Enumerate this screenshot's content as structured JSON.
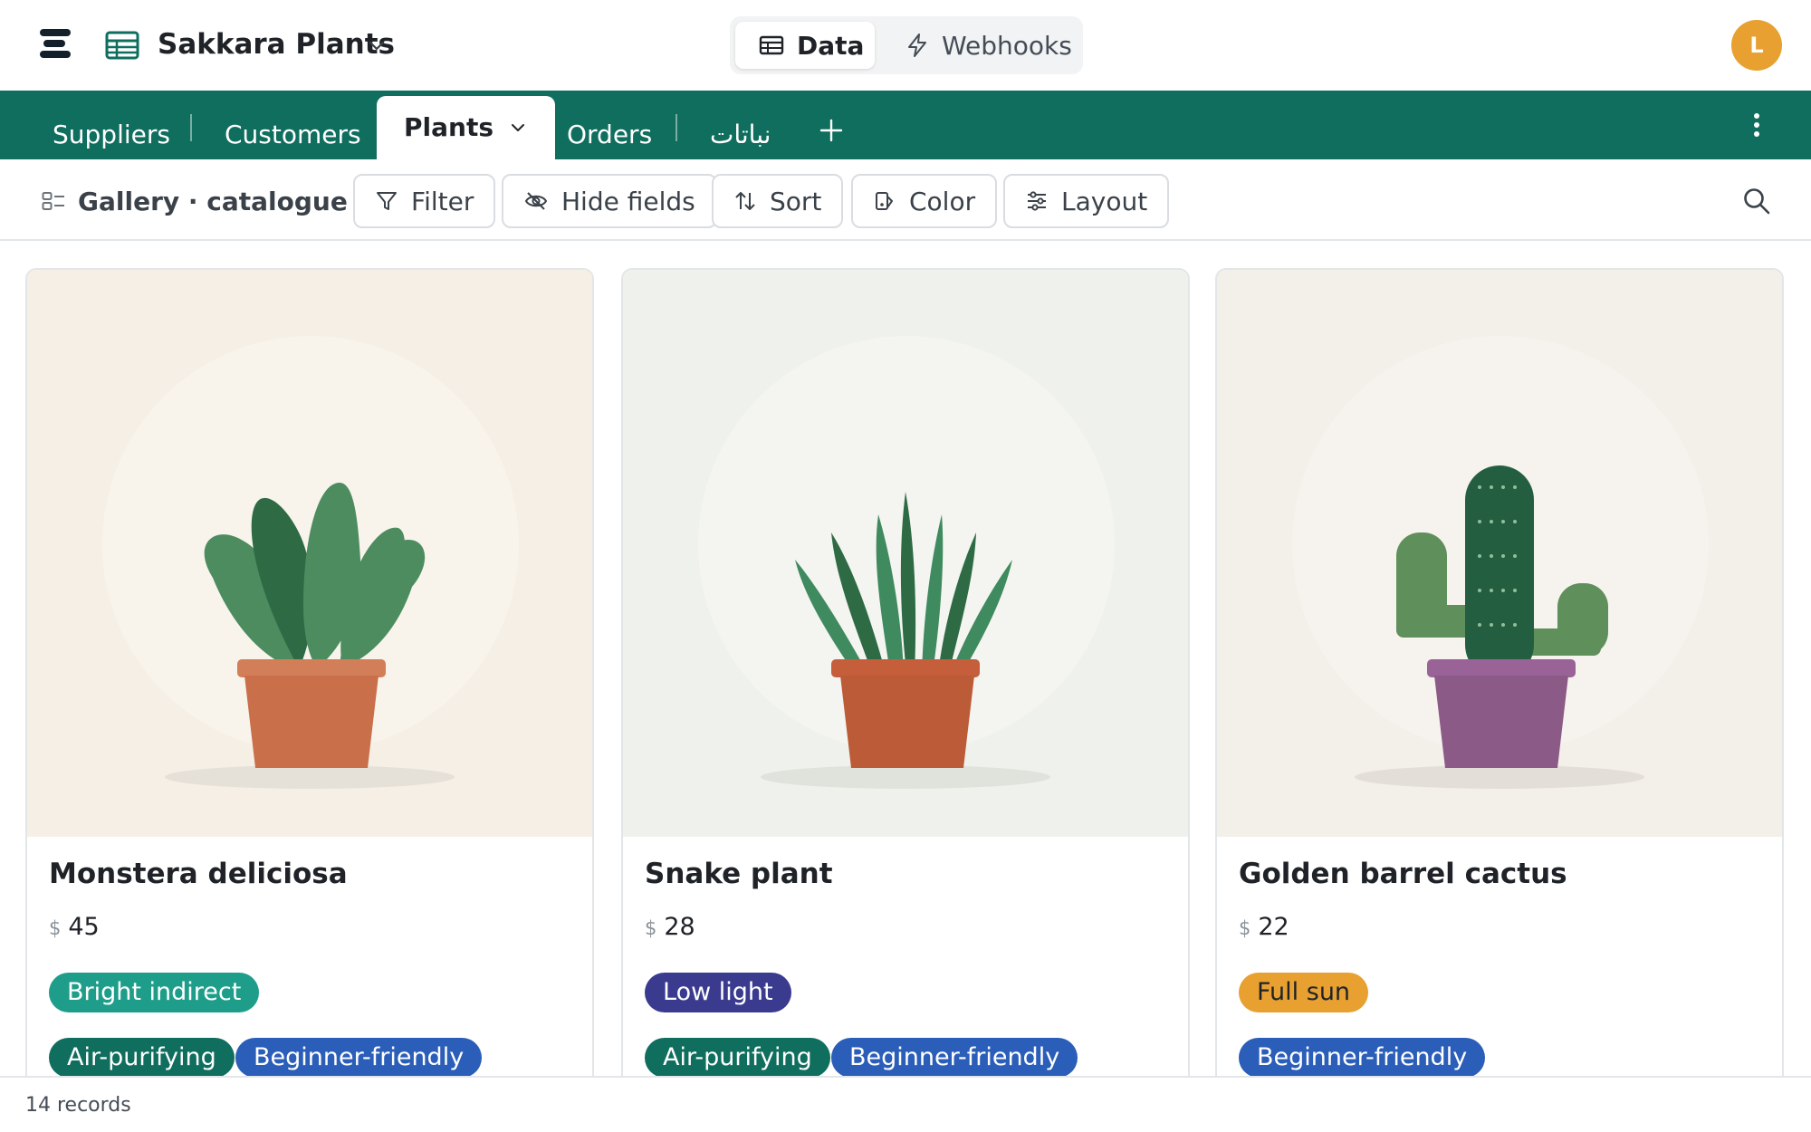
{
  "app": {
    "base_name": "Sakkara Plants",
    "avatar_initial": "L",
    "mode_tabs": [
      {
        "label": "Data",
        "icon": "table-icon",
        "active": true
      },
      {
        "label": "Webhooks",
        "icon": "lightning-icon",
        "active": false
      }
    ]
  },
  "tables": [
    {
      "label": "Suppliers",
      "active": false
    },
    {
      "label": "Customers",
      "active": false
    },
    {
      "label": "Plants",
      "active": true
    },
    {
      "label": "Orders",
      "active": false
    },
    {
      "label": "نباتات",
      "active": false
    }
  ],
  "toolbar": {
    "view_label": "Gallery · catalogue",
    "filter": "Filter",
    "hide_fields": "Hide fields",
    "sort": "Sort",
    "color": "Color",
    "layout": "Layout"
  },
  "cards": [
    {
      "title": "Monstera deliciosa",
      "currency": "$",
      "price": "45",
      "light": {
        "label": "Bright indirect",
        "color": "#1e9e8a"
      },
      "tags": [
        {
          "label": "Air-purifying",
          "color": "#0f6e5e"
        },
        {
          "label": "Beginner-friendly",
          "color": "#2b5eb8"
        }
      ],
      "image_icon": "monstera-plant-icon"
    },
    {
      "title": "Snake plant",
      "currency": "$",
      "price": "28",
      "light": {
        "label": "Low light",
        "color": "#3a3b8f"
      },
      "tags": [
        {
          "label": "Air-purifying",
          "color": "#0f6e5e"
        },
        {
          "label": "Beginner-friendly",
          "color": "#2b5eb8"
        }
      ],
      "image_icon": "snake-plant-icon"
    },
    {
      "title": "Golden barrel cactus",
      "currency": "$",
      "price": "22",
      "light": {
        "label": "Full sun",
        "color": "#e8a030"
      },
      "tags": [
        {
          "label": "Beginner-friendly",
          "color": "#2b5eb8"
        }
      ],
      "image_icon": "cactus-plant-icon"
    }
  ],
  "footer": {
    "record_count": "14 records"
  },
  "colors": {
    "accent": "#0f6e5e",
    "avatar": "#e8a030"
  }
}
